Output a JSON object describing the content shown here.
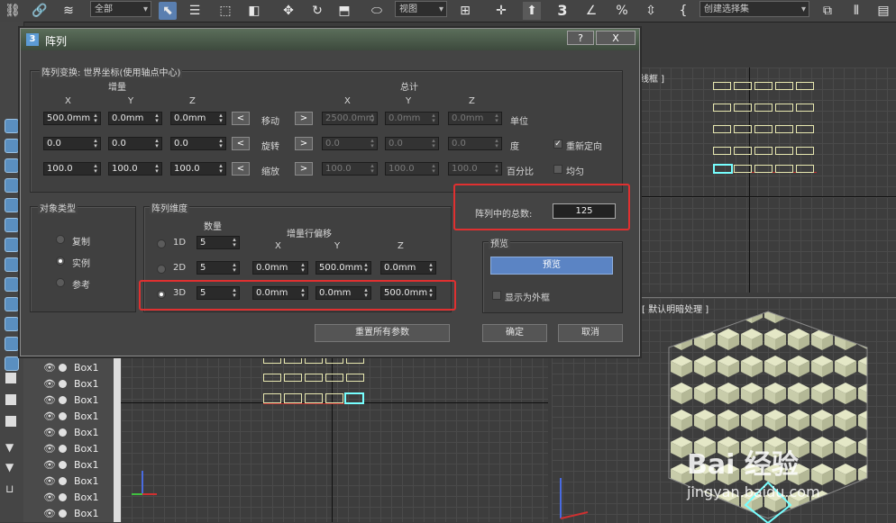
{
  "toolbar": {
    "filter_value": "全部",
    "view_value": "视图",
    "snap_value": "3",
    "selection_set_value": "创建选择集"
  },
  "dialog": {
    "title_icon": "3",
    "title": "阵列",
    "help_label": "?",
    "close_label": "X",
    "transform_group": {
      "title": "阵列变换: 世界坐标(使用轴点中心)",
      "increment_label": "增量",
      "total_label": "总计",
      "axis_x": "X",
      "axis_y": "Y",
      "axis_z": "Z",
      "rows": [
        {
          "inc": [
            "500.0mm",
            "0.0mm",
            "0.0mm"
          ],
          "left_btn": "<",
          "name": "移动",
          "right_btn": ">",
          "tot": [
            "2500.0mm",
            "0.0mm",
            "0.0mm"
          ],
          "unit": "单位"
        },
        {
          "inc": [
            "0.0",
            "0.0",
            "0.0"
          ],
          "left_btn": "<",
          "name": "旋转",
          "right_btn": ">",
          "tot": [
            "0.0",
            "0.0",
            "0.0"
          ],
          "unit": "度"
        },
        {
          "inc": [
            "100.0",
            "100.0",
            "100.0"
          ],
          "left_btn": "<",
          "name": "缩放",
          "right_btn": ">",
          "tot": [
            "100.0",
            "100.0",
            "100.0"
          ],
          "unit": "百分比"
        }
      ],
      "reorient_label": "重新定向",
      "reorient_checked": true,
      "uniform_label": "均匀",
      "uniform_checked": false
    },
    "object_type": {
      "title": "对象类型",
      "options": [
        "复制",
        "实例",
        "参考"
      ],
      "selected": "实例"
    },
    "array_dimensions": {
      "title": "阵列维度",
      "count_label": "数量",
      "offset_label": "增量行偏移",
      "axis_x": "X",
      "axis_y": "Y",
      "axis_z": "Z",
      "rows": [
        {
          "name": "1D",
          "count": "5",
          "x": "",
          "y": "",
          "z": ""
        },
        {
          "name": "2D",
          "count": "5",
          "x": "0.0mm",
          "y": "500.0mm",
          "z": "0.0mm"
        },
        {
          "name": "3D",
          "count": "5",
          "x": "0.0mm",
          "y": "0.0mm",
          "z": "500.0mm"
        }
      ],
      "selected": "3D"
    },
    "total_in_array_label": "阵列中的总数:",
    "total_in_array_value": "125",
    "preview": {
      "title": "预览",
      "button_label": "预览",
      "accent_color": "#5b84c4",
      "show_as_box_label": "显示为外框",
      "show_as_box_checked": false
    },
    "reset_label": "重置所有参数",
    "ok_label": "确定",
    "cancel_label": "取消"
  },
  "viewports": {
    "top_label": "线框 ]",
    "persp_label": "[ 默认明暗处理 ]"
  },
  "scene_list": {
    "items": [
      "Box1",
      "Box1",
      "Box1",
      "Box1",
      "Box1",
      "Box1",
      "Box1",
      "Box1",
      "Box1",
      "Box1"
    ]
  },
  "watermark": {
    "brand": "Bai 经验",
    "url": "jingyan.baidu.com"
  }
}
